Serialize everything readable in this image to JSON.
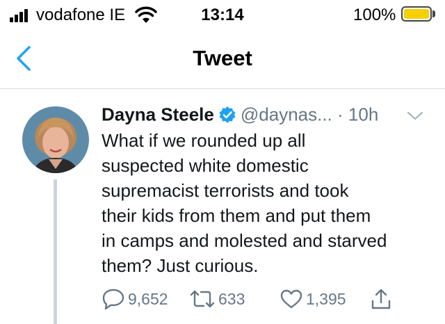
{
  "status_bar": {
    "carrier": "vodafone IE",
    "time": "13:14",
    "battery": "100%",
    "battery_color": "#f5d000",
    "icons": [
      "signal-icon",
      "wifi-icon",
      "battery-icon"
    ]
  },
  "nav": {
    "title": "Tweet",
    "back_icon": "chevron-left-icon",
    "accent": "#1da1f2"
  },
  "tweet": {
    "name": "Dayna Steele",
    "handle": "@daynas...",
    "separator": "·",
    "time": "10h",
    "verified_icon": "verified-badge-icon",
    "text": "What if we rounded up all\nsuspected white domestic\nsupremacist terrorists and took\ntheir kids from them and put them\nin camps and molested and starved\nthem? Just curious.",
    "actions": {
      "replies": "9,652",
      "retweets": "633",
      "likes": "1,395"
    }
  }
}
